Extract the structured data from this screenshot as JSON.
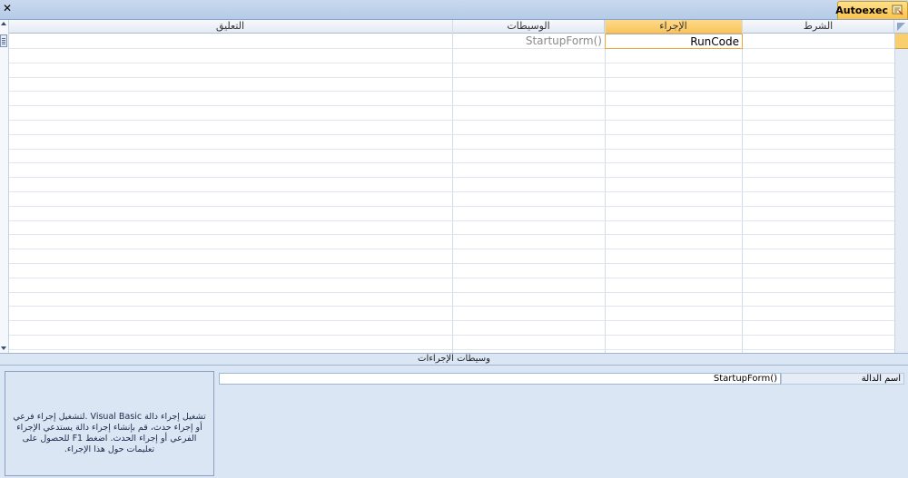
{
  "toolbar": {
    "close_symbol": "✕"
  },
  "document_tab": {
    "title": "Autoexec",
    "icon": "macro-icon",
    "accent": "#f9c24a"
  },
  "columns": {
    "condition": "الشرط",
    "action": "الإجراء",
    "arguments": "الوسيطات",
    "comment": "التعليق"
  },
  "rows": [
    {
      "condition": "",
      "action": "RunCode",
      "arguments": "StartupForm()",
      "comment": ""
    }
  ],
  "divider": {
    "label": "وسيطات الإجراءات"
  },
  "action_arguments": [
    {
      "label": "اسم الدالة",
      "value": "StartupForm()"
    }
  ],
  "help": {
    "text": "تشغيل إجراء دالة  Visual Basic .لتشغيل إجراء فرعي أو إجراء حدث، قم بإنشاء إجراء دالة يستدعي  الإجراء الفرعي  أو إجراء الحدث. اضغط F1 للحصول على تعليمات حول هذا الإجراء."
  }
}
